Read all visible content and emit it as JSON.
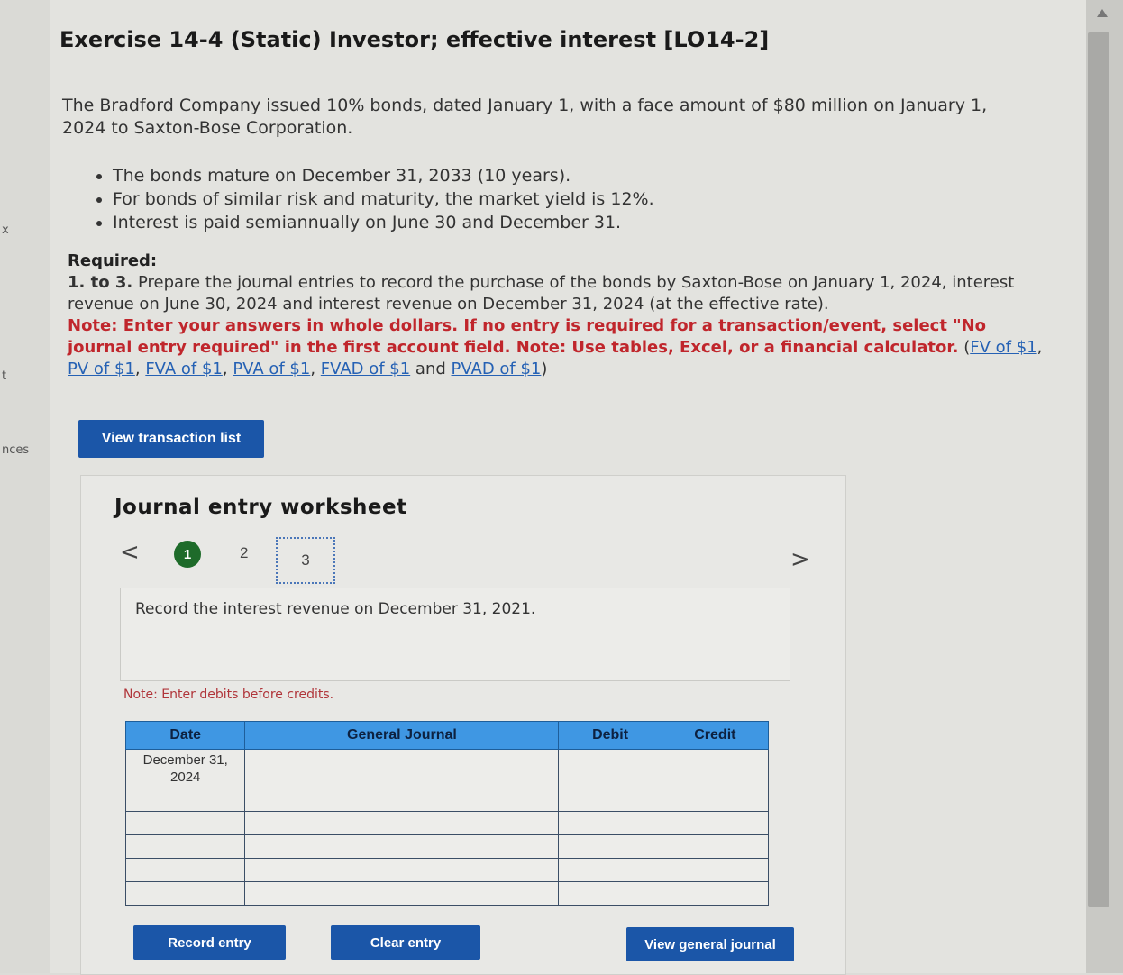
{
  "gutter": {
    "item_a": "x",
    "item_b": "t",
    "item_c": "nces"
  },
  "exercise": {
    "title": "Exercise 14-4 (Static) Investor; effective interest [LO14-2]",
    "intro": "The Bradford Company issued 10% bonds, dated January 1, with a face amount of $80 million on January 1, 2024 to Saxton-Bose Corporation.",
    "bullets": [
      "The bonds mature on December 31, 2033 (10 years).",
      "For bonds of similar risk and maturity, the market yield is 12%.",
      "Interest is paid semiannually on June 30 and December 31."
    ]
  },
  "required": {
    "title": "Required:",
    "lead": "1. to 3.",
    "text": " Prepare the journal entries to record the purchase of the bonds by Saxton-Bose on January 1, 2024, interest revenue on June 30, 2024 and interest revenue on December 31, 2024 (at the effective rate).",
    "note": "Note: Enter your answers in whole dollars. If no entry is required for a transaction/event, select \"No journal entry required\" in the first account field. Note: Use tables, Excel, or a financial calculator.",
    "links": [
      "FV of $1",
      "PV of $1",
      "FVA of $1",
      "PVA of $1",
      "FVAD of $1",
      "PVAD of $1"
    ]
  },
  "buttons": {
    "view_transactions": "View transaction list",
    "record_entry": "Record entry",
    "clear_entry": "Clear entry",
    "view_general_journal": "View general journal"
  },
  "worksheet": {
    "title": "Journal entry worksheet",
    "prev": "<",
    "next": ">",
    "steps": [
      "1",
      "2",
      "3"
    ],
    "instruction": "Record the interest revenue on December 31, 2021.",
    "note": "Note: Enter debits before credits."
  },
  "journal": {
    "headers": [
      "Date",
      "General Journal",
      "Debit",
      "Credit"
    ],
    "date": "December 31, 2024",
    "rows": 6
  },
  "colors": {
    "primary_button": "#1b56a8",
    "table_header": "#3f97e3",
    "step_active": "#1e6b2a",
    "note_red": "#c0262c",
    "link_blue": "#2561b4"
  }
}
